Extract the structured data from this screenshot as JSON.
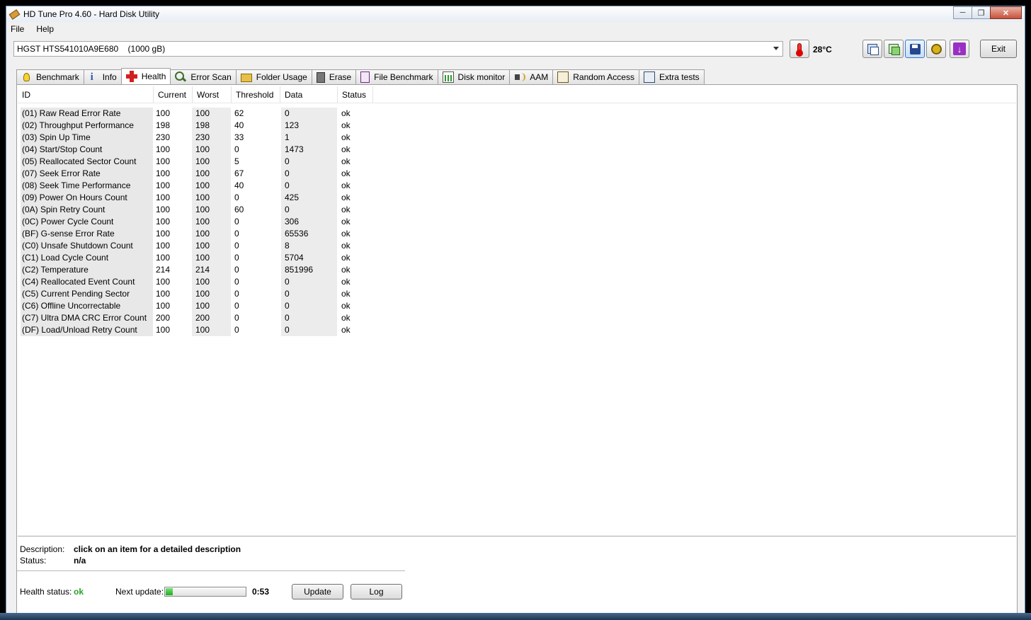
{
  "window": {
    "title": "HD Tune Pro 4.60 - Hard Disk Utility",
    "minimize_glyph": "─",
    "maximize_glyph": "❐",
    "close_glyph": "✕"
  },
  "menu": [
    {
      "label": "File"
    },
    {
      "label": "Help"
    }
  ],
  "toolbar": {
    "drive": "HGST HTS541010A9E680    (1000 gB)",
    "temperature": "28°C",
    "exit_label": "Exit",
    "icons": [
      "thermometer-icon",
      "copy-text-icon",
      "copy-screenshot-icon",
      "save-icon",
      "options-icon",
      "download-icon"
    ]
  },
  "tabs": [
    {
      "label": "Benchmark",
      "icon": "benchmark-bulb-icon"
    },
    {
      "label": "Info",
      "icon": "info-icon"
    },
    {
      "label": "Health",
      "icon": "health-cross-icon",
      "active": true
    },
    {
      "label": "Error Scan",
      "icon": "magnifier-icon"
    },
    {
      "label": "Folder Usage",
      "icon": "folder-icon"
    },
    {
      "label": "Erase",
      "icon": "trash-icon"
    },
    {
      "label": "File Benchmark",
      "icon": "file-benchmark-icon"
    },
    {
      "label": "Disk monitor",
      "icon": "disk-monitor-icon"
    },
    {
      "label": "AAM",
      "icon": "speaker-icon"
    },
    {
      "label": "Random Access",
      "icon": "random-access-icon"
    },
    {
      "label": "Extra tests",
      "icon": "extra-tests-icon"
    }
  ],
  "table": {
    "columns": [
      "ID",
      "Current",
      "Worst",
      "Threshold",
      "Data",
      "Status"
    ],
    "rows": [
      [
        "(01) Raw Read Error Rate",
        "100",
        "100",
        "62",
        "0",
        "ok"
      ],
      [
        "(02) Throughput Performance",
        "198",
        "198",
        "40",
        "123",
        "ok"
      ],
      [
        "(03) Spin Up Time",
        "230",
        "230",
        "33",
        "1",
        "ok"
      ],
      [
        "(04) Start/Stop Count",
        "100",
        "100",
        "0",
        "1473",
        "ok"
      ],
      [
        "(05) Reallocated Sector Count",
        "100",
        "100",
        "5",
        "0",
        "ok"
      ],
      [
        "(07) Seek Error Rate",
        "100",
        "100",
        "67",
        "0",
        "ok"
      ],
      [
        "(08) Seek Time Performance",
        "100",
        "100",
        "40",
        "0",
        "ok"
      ],
      [
        "(09) Power On Hours Count",
        "100",
        "100",
        "0",
        "425",
        "ok"
      ],
      [
        "(0A) Spin Retry Count",
        "100",
        "100",
        "60",
        "0",
        "ok"
      ],
      [
        "(0C) Power Cycle Count",
        "100",
        "100",
        "0",
        "306",
        "ok"
      ],
      [
        "(BF) G-sense Error Rate",
        "100",
        "100",
        "0",
        "65536",
        "ok"
      ],
      [
        "(C0) Unsafe Shutdown Count",
        "100",
        "100",
        "0",
        "8",
        "ok"
      ],
      [
        "(C1) Load Cycle Count",
        "100",
        "100",
        "0",
        "5704",
        "ok"
      ],
      [
        "(C2) Temperature",
        "214",
        "214",
        "0",
        "851996",
        "ok"
      ],
      [
        "(C4) Reallocated Event Count",
        "100",
        "100",
        "0",
        "0",
        "ok"
      ],
      [
        "(C5) Current Pending Sector",
        "100",
        "100",
        "0",
        "0",
        "ok"
      ],
      [
        "(C6) Offline Uncorrectable",
        "100",
        "100",
        "0",
        "0",
        "ok"
      ],
      [
        "(C7) Ultra DMA CRC Error Count",
        "200",
        "200",
        "0",
        "0",
        "ok"
      ],
      [
        "(DF) Load/Unload Retry Count",
        "100",
        "100",
        "0",
        "0",
        "ok"
      ]
    ]
  },
  "description": {
    "label": "Description:",
    "value": "click on an item for a detailed description",
    "status_label": "Status:",
    "status_value": "n/a"
  },
  "footer": {
    "health_label": "Health status:",
    "health_value": "ok",
    "health_color": "#2aa02a",
    "next_update_label": "Next update:",
    "next_update_progress": 0.09,
    "next_update_time": "0:53",
    "update_label": "Update",
    "log_label": "Log"
  }
}
